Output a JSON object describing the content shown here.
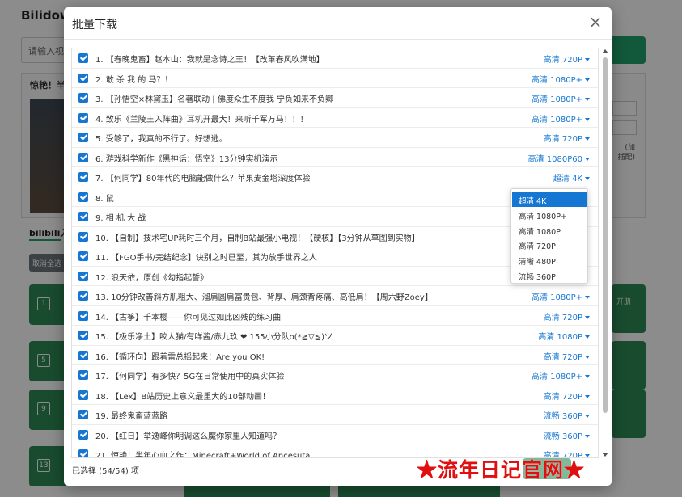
{
  "background": {
    "app_title": "Bilidow",
    "url_placeholder": "请输入视频",
    "card_title": "惊艳！半",
    "side_texts": [
      "(加",
      "插配)"
    ],
    "section_title": "bilibili入",
    "cancel_label": "取消全选",
    "item_numbers": [
      "1",
      "5",
      "9",
      "13"
    ],
    "right_item_texts": [
      "开册"
    ]
  },
  "modal": {
    "title": "批量下载",
    "close_label": "×",
    "status": "已选择 (54/54) 项"
  },
  "rows": [
    {
      "title": "1. 【春晚鬼畜】赵本山：我就是念诗之王！【改革春风吹满地】",
      "quality": "高清 720P"
    },
    {
      "title": "2. 敢 杀 我 的 马？！",
      "quality": "高清 1080P+"
    },
    {
      "title": "3. 【孙悟空×林黛玉】名著联动 | 佛度众生不度我 宁负如来不负卿",
      "quality": "高清 1080P+"
    },
    {
      "title": "4. 致乐《兰陵王入阵曲》耳机开最大！来听千军万马！！！",
      "quality": "高清 1080P+"
    },
    {
      "title": "5. 受够了，我真的不行了。好想逃。",
      "quality": "高清 720P"
    },
    {
      "title": "6. 游戏科学新作《黑神话：悟空》13分钟实机演示",
      "quality": "高清 1080P60"
    },
    {
      "title": "7. 【何同学】80年代的电脑能做什么？苹果麦金塔深度体验",
      "quality": "超清 4K"
    },
    {
      "title": "8. 鼠",
      "quality": ""
    },
    {
      "title": "9. 相 机 大 战",
      "quality": ""
    },
    {
      "title": "10. 【自制】技术宅UP耗时三个月，自制B站最强小电视！【硬核】【3分钟从草图到实物】",
      "quality": ""
    },
    {
      "title": "11. 【FGO手书/完结纪念】诀别之时已至，其为放手世界之人",
      "quality": ""
    },
    {
      "title": "12. 浪天依，原创《勾指起誓》",
      "quality": ""
    },
    {
      "title": "13. 10分钟改善斜方肌粗大、溜肩圆肩富贵包、背厚、肩颈背疼痛、高低肩！【周六野Zoey】",
      "quality": "高清 1080P+"
    },
    {
      "title": "14. 【古筝】千本樱——你可见过如此凶残的练习曲",
      "quality": "高清 720P"
    },
    {
      "title": "15. 【极乐净土】咬人猫/有咩酱/赤九玖 ❤ 155小分队o(*≧▽≦)ツ",
      "quality": "高清 1080P"
    },
    {
      "title": "16. 【循环向】跟着雷总摇起来！Are you OK!",
      "quality": "高清 720P"
    },
    {
      "title": "17. 【何同学】有多快？5G在日常使用中的真实体验",
      "quality": "高清 1080P+"
    },
    {
      "title": "18. 【Lex】B站历史上意义最重大的10部动画！",
      "quality": "高清 720P"
    },
    {
      "title": "19. 最终鬼畜蓝蓝路",
      "quality": "流畅 360P"
    },
    {
      "title": "20. 【红日】举逸峰你明调这么魔你家里人知道吗？",
      "quality": "流畅 360P"
    },
    {
      "title": "21. 惊艳！半年心血之作：Minecraft+World of Ancesuta",
      "quality": "高清 720P"
    }
  ],
  "dropdown_options": [
    {
      "label": "超清 4K",
      "active": true
    },
    {
      "label": "高清 1080P+",
      "active": false
    },
    {
      "label": "高清 1080P",
      "active": false
    },
    {
      "label": "高清 720P",
      "active": false
    },
    {
      "label": "清晰 480P",
      "active": false
    },
    {
      "label": "流畅 360P",
      "active": false
    }
  ],
  "watermark": "★流年日记官网★",
  "colors": {
    "accent": "#1677d2",
    "green": "#2e8b57",
    "watermark": "#e01010"
  }
}
